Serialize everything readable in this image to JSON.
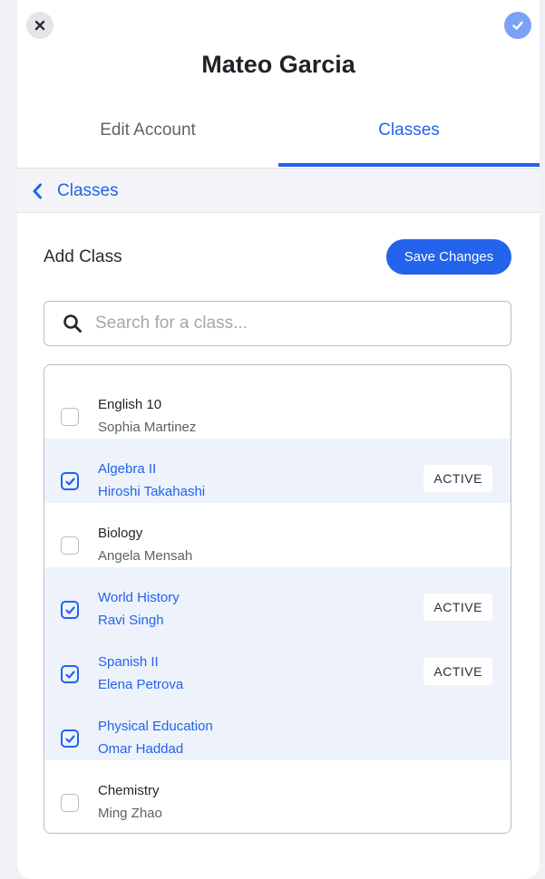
{
  "header": {
    "title": "Mateo Garcia",
    "close_icon": "close-icon",
    "confirm_icon": "check-icon"
  },
  "tabs": [
    {
      "label": "Edit Account",
      "selected": false
    },
    {
      "label": "Classes",
      "selected": true
    }
  ],
  "breadcrumb": {
    "label": "Classes",
    "icon": "chevron-left-icon"
  },
  "section": {
    "title": "Add Class",
    "save_label": "Save Changes"
  },
  "search": {
    "placeholder": "Search for a class...",
    "value": "",
    "icon": "search-icon"
  },
  "classes": [
    {
      "name": "English 10",
      "teacher": "Sophia Martinez",
      "checked": false,
      "badge": ""
    },
    {
      "name": "Algebra II",
      "teacher": "Hiroshi Takahashi",
      "checked": true,
      "badge": "ACTIVE"
    },
    {
      "name": "Biology",
      "teacher": "Angela Mensah",
      "checked": false,
      "badge": ""
    },
    {
      "name": "World History",
      "teacher": "Ravi Singh",
      "checked": true,
      "badge": "ACTIVE"
    },
    {
      "name": "Spanish II",
      "teacher": "Elena Petrova",
      "checked": true,
      "badge": "ACTIVE"
    },
    {
      "name": "Physical Education",
      "teacher": "Omar Haddad",
      "checked": true,
      "badge": ""
    },
    {
      "name": "Chemistry",
      "teacher": "Ming Zhao",
      "checked": false,
      "badge": ""
    }
  ],
  "colors": {
    "accent": "#2463eb",
    "active_row": "#edf2fb",
    "confirm_button": "#7aa3f5"
  }
}
